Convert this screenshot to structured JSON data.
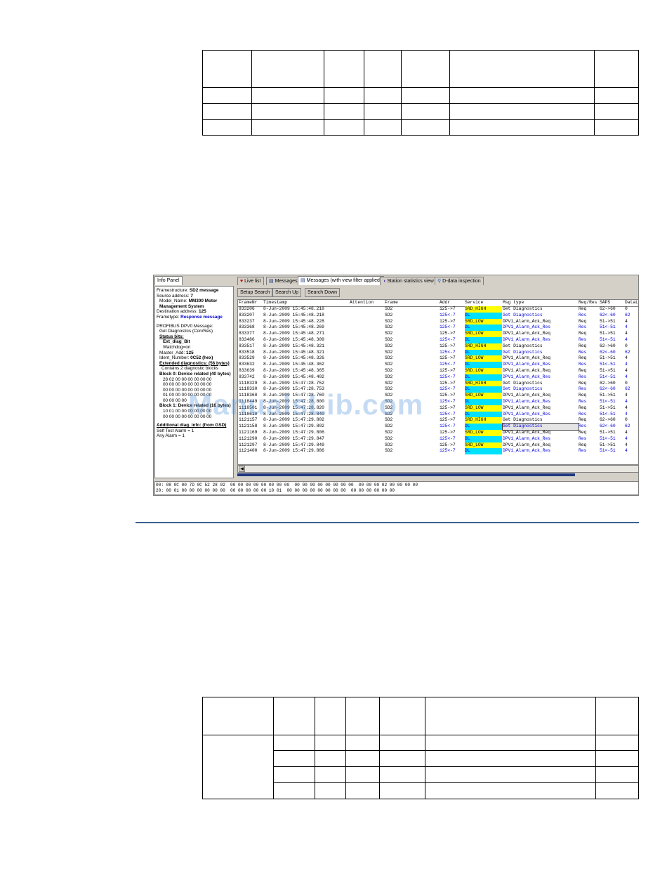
{
  "watermark": "ManualsLib.com",
  "app": {
    "info_tab": "Info Panel",
    "tabs": [
      {
        "label": "Live list",
        "icon": "heart-icon"
      },
      {
        "label": "Messages",
        "icon": "messages-icon"
      },
      {
        "label": "Messages (with view filter applied)",
        "icon": "filtered-messages-icon"
      },
      {
        "label": "Station statistics view",
        "icon": "statistics-icon"
      },
      {
        "label": "D-data inspection",
        "icon": "magnifier-icon"
      }
    ],
    "buttons": {
      "setup_search": "Setup Search",
      "search_up": "Search Up",
      "search_down": "Search Down"
    },
    "info": {
      "framestructure_label": "Framestructure:",
      "framestructure_value": "SD2 message",
      "source_label": "Source address:",
      "source_value": "7",
      "model_label": "Model_Name:",
      "model_value": "MM300 Motor Management System",
      "dest_label": "Destination address:",
      "dest_value": "125",
      "frametype_label": "Frametype:",
      "frametype_value": "Response message",
      "profibus": "PROFIBUS DPV0 Message:",
      "getdiag": "Get Diagnostics (Con/Res)",
      "status_bits": "Status bits:",
      "ext_diag": "Ext_diag_Bit",
      "watchdog": "Watchdog=on",
      "master_label": "Master_Add:",
      "master_value": "125",
      "ident_label": "Ident_Number:",
      "ident_value": "0C52 (hex)",
      "ext_diagnostics": "Extended diagnostics: (56 bytes)",
      "contains": "Contains 2 diagnostic blocks",
      "block0": "Block 0: Device related (40 bytes)",
      "block0_hex": [
        "28 02 00 00 00 00 00 00",
        "00 00 00 00 00 00 00 00",
        "00 00 00 00 00 00 00 00",
        "01 00 00 00 00 00 00 00",
        "00 00 00 00"
      ],
      "block1": "Block 1: Device related (16 bytes)",
      "block1_hex": [
        "10 01 00 00 00 00 00 00",
        "00 00 00 00 00 00 00 00"
      ],
      "additional": "Additional diag. info: (from GSD)",
      "self_test": "Self Test Alarm = 1",
      "any_alarm": "Any Alarm = 1"
    },
    "grid": {
      "columns": [
        "FrameNr",
        "Timestamp",
        "Attention",
        "Frame",
        "Addr",
        "Service",
        "Msg type",
        "Req/Res",
        "SAPS",
        "DataLen"
      ],
      "rows": [
        [
          "833206",
          "8-Jun-2009 15:45:48.218",
          "",
          "SD2",
          "125->7",
          "SRD_HIGH",
          "Get Diagnostics",
          "Req",
          "62->60",
          "0"
        ],
        [
          "833207",
          "8-Jun-2009 15:45:48.218",
          "",
          "SD2",
          "125<-7",
          "DL",
          "Get Diagnostics",
          "Res",
          "62<-60",
          "62"
        ],
        [
          "833237",
          "8-Jun-2009 15:45:48.228",
          "",
          "SD2",
          "125->7",
          "SRD_LOW",
          "DPV1_Alarm_Ack_Req",
          "Req",
          "51->51",
          "4"
        ],
        [
          "833368",
          "8-Jun-2009 15:45:48.269",
          "",
          "SD2",
          "125<-7",
          "DL",
          "DPV1_Alarm_Ack_Res",
          "Res",
          "51<-51",
          "4"
        ],
        [
          "833377",
          "8-Jun-2009 15:45:48.271",
          "",
          "SD2",
          "125->7",
          "SRD_LOW",
          "DPV1_Alarm_Ack_Req",
          "Req",
          "51->51",
          "4"
        ],
        [
          "833486",
          "8-Jun-2009 15:45:48.309",
          "",
          "SD2",
          "125<-7",
          "DL",
          "DPV1_Alarm_Ack_Res",
          "Res",
          "51<-51",
          "4"
        ],
        [
          "833517",
          "8-Jun-2009 15:45:48.321",
          "",
          "SD2",
          "125->7",
          "SRD_HIGH",
          "Get Diagnostics",
          "Req",
          "62->60",
          "0"
        ],
        [
          "833518",
          "8-Jun-2009 15:45:48.321",
          "",
          "SD2",
          "125<-7",
          "DL",
          "Get Diagnostics",
          "Res",
          "62<-60",
          "62"
        ],
        [
          "833529",
          "8-Jun-2009 15:45:48.326",
          "",
          "SD2",
          "125->7",
          "SRD_LOW",
          "DPV1_Alarm_Ack_Req",
          "Req",
          "51->51",
          "4"
        ],
        [
          "833632",
          "8-Jun-2009 15:45:48.362",
          "",
          "SD2",
          "125<-7",
          "DL",
          "DPV1_Alarm_Ack_Res",
          "Res",
          "51<-51",
          "4"
        ],
        [
          "833639",
          "8-Jun-2009 15:45:48.365",
          "",
          "SD2",
          "125->7",
          "SRD_LOW",
          "DPV1_Alarm_Ack_Req",
          "Req",
          "51->51",
          "4"
        ],
        [
          "833742",
          "8-Jun-2009 15:45:48.402",
          "",
          "SD2",
          "125<-7",
          "DL",
          "DPV1_Alarm_Ack_Res",
          "Res",
          "51<-51",
          "4"
        ],
        [
          "1118329",
          "8-Jun-2009 15:47:28.752",
          "",
          "SD2",
          "125->7",
          "SRD_HIGH",
          "Get Diagnostics",
          "Req",
          "62->60",
          "0"
        ],
        [
          "1118330",
          "8-Jun-2009 15:47:28.753",
          "",
          "SD2",
          "125<-7",
          "DL",
          "Get Diagnostics",
          "Res",
          "62<-60",
          "62"
        ],
        [
          "1118360",
          "8-Jun-2009 15:47:28.760",
          "",
          "SD2",
          "125->7",
          "SRD_LOW",
          "DPV1_Alarm_Ack_Req",
          "Req",
          "51->51",
          "4"
        ],
        [
          "1118449",
          "8-Jun-2009 15:47:28.800",
          "",
          "SD2",
          "125<-7",
          "DL",
          "DPV1_Alarm_Ack_Res",
          "Res",
          "51<-51",
          "4"
        ],
        [
          "1118501",
          "8-Jun-2009 15:47:28.820",
          "",
          "SD2",
          "125->7",
          "SRD_LOW",
          "DPV1_Alarm_Ack_Req",
          "Req",
          "51->51",
          "4"
        ],
        [
          "1118610",
          "8-Jun-2009 15:47:28.840",
          "",
          "SD2",
          "125<-7",
          "DL",
          "DPV1_Alarm_Ack_Res",
          "Res",
          "51<-51",
          "4"
        ],
        [
          "1121157",
          "8-Jun-2009 15:47:29.802",
          "",
          "SD2",
          "125->7",
          "SRD_HIGH",
          "Get Diagnostics",
          "Req",
          "62->60",
          "0"
        ],
        [
          "1121158",
          "8-Jun-2009 15:47:29.802",
          "",
          "SD2",
          "125<-7",
          "DL",
          "Get Diagnostics",
          "Res",
          "62<-60",
          "62"
        ],
        [
          "1121169",
          "8-Jun-2009 15:47:29.806",
          "",
          "SD2",
          "125->7",
          "SRD_LOW",
          "DPV1_Alarm_Ack_Req",
          "Req",
          "51->51",
          "4"
        ],
        [
          "1121290",
          "8-Jun-2009 15:47:29.847",
          "",
          "SD2",
          "125<-7",
          "DL",
          "DPV1_Alarm_Ack_Res",
          "Res",
          "51<-51",
          "4"
        ],
        [
          "1121297",
          "8-Jun-2009 15:47:29.849",
          "",
          "SD2",
          "125->7",
          "SRD_LOW",
          "DPV1_Alarm_Ack_Req",
          "Req",
          "51->51",
          "4"
        ],
        [
          "1121400",
          "8-Jun-2009 15:47:29.886",
          "",
          "SD2",
          "125<-7",
          "DL",
          "DPV1_Alarm_Ack_Res",
          "Res",
          "51<-51",
          "4"
        ]
      ],
      "selected_row": 19
    },
    "progress_fraction": 0.84,
    "hex_lines": [
      "00: 08 0C 00 7D 0C 52 28 02  00 00 00 00 00 00 00 00  00 00 00 00 00 00 00 00  00 00 00 02 00 00 00 00",
      "20: 00 01 00 00 00 00 00 00  00 00 00 00 00 10 01  00 00 00 00 00 00 00 00  00 00 00 00 00 00"
    ],
    "colors": {
      "srd_bg": "#ffff00",
      "dl_bg": "#00e0ff",
      "response_text": "#0000dd"
    }
  }
}
